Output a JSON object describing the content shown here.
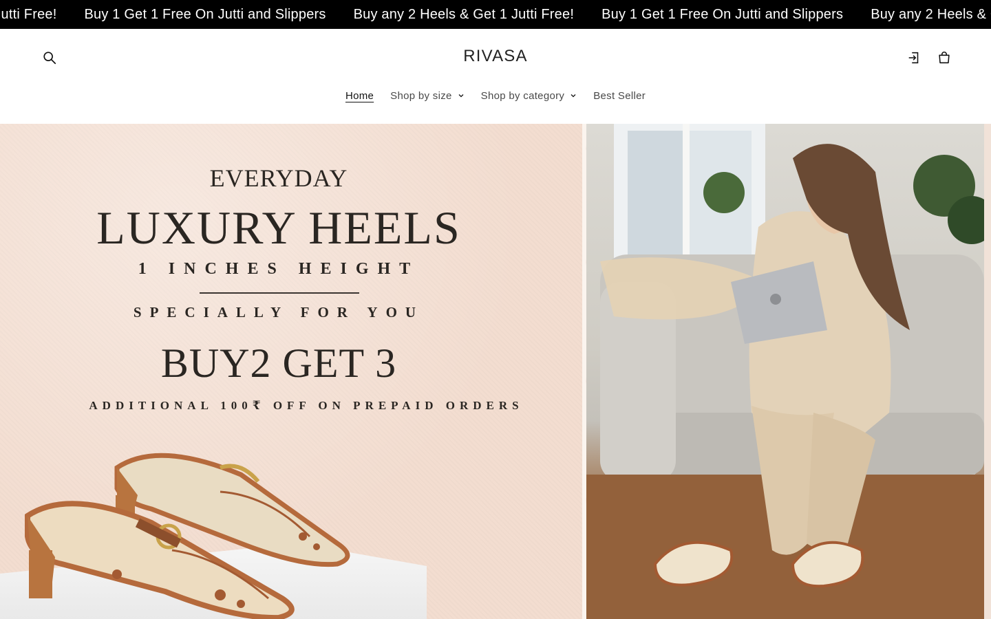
{
  "announcement": {
    "items": [
      "Buy any 2 Heels & Get 1 Jutti Free!",
      "Buy 1 Get 1 Free On Jutti and Slippers",
      "Buy any 2 Heels & Get 1 Jutti Free!",
      "Buy 1 Get 1 Free On Jutti and Slippers",
      "Buy any 2 Heels & Get 1 Jutti Free!"
    ]
  },
  "header": {
    "logo": "RIVASA",
    "icons": {
      "search": "search-icon",
      "account": "account-icon",
      "cart": "cart-icon"
    }
  },
  "nav": {
    "items": [
      {
        "label": "Home",
        "active": true
      },
      {
        "label": "Shop by size",
        "has_dropdown": true
      },
      {
        "label": "Shop by category",
        "has_dropdown": true
      },
      {
        "label": "Best Seller"
      }
    ]
  },
  "hero": {
    "line1": "EVERYDAY",
    "line2": "LUXURY HEELS",
    "line3": "1 INCHES HEIGHT",
    "line4": "SPECIALLY FOR YOU",
    "line5": "BUY2 GET 3",
    "line6": "ADDITIONAL 100₹ OFF ON PREPAID ORDERS"
  },
  "colors": {
    "announcement_bg": "#000000",
    "hero_bg": "#f3ddd0",
    "text": "#121212"
  }
}
